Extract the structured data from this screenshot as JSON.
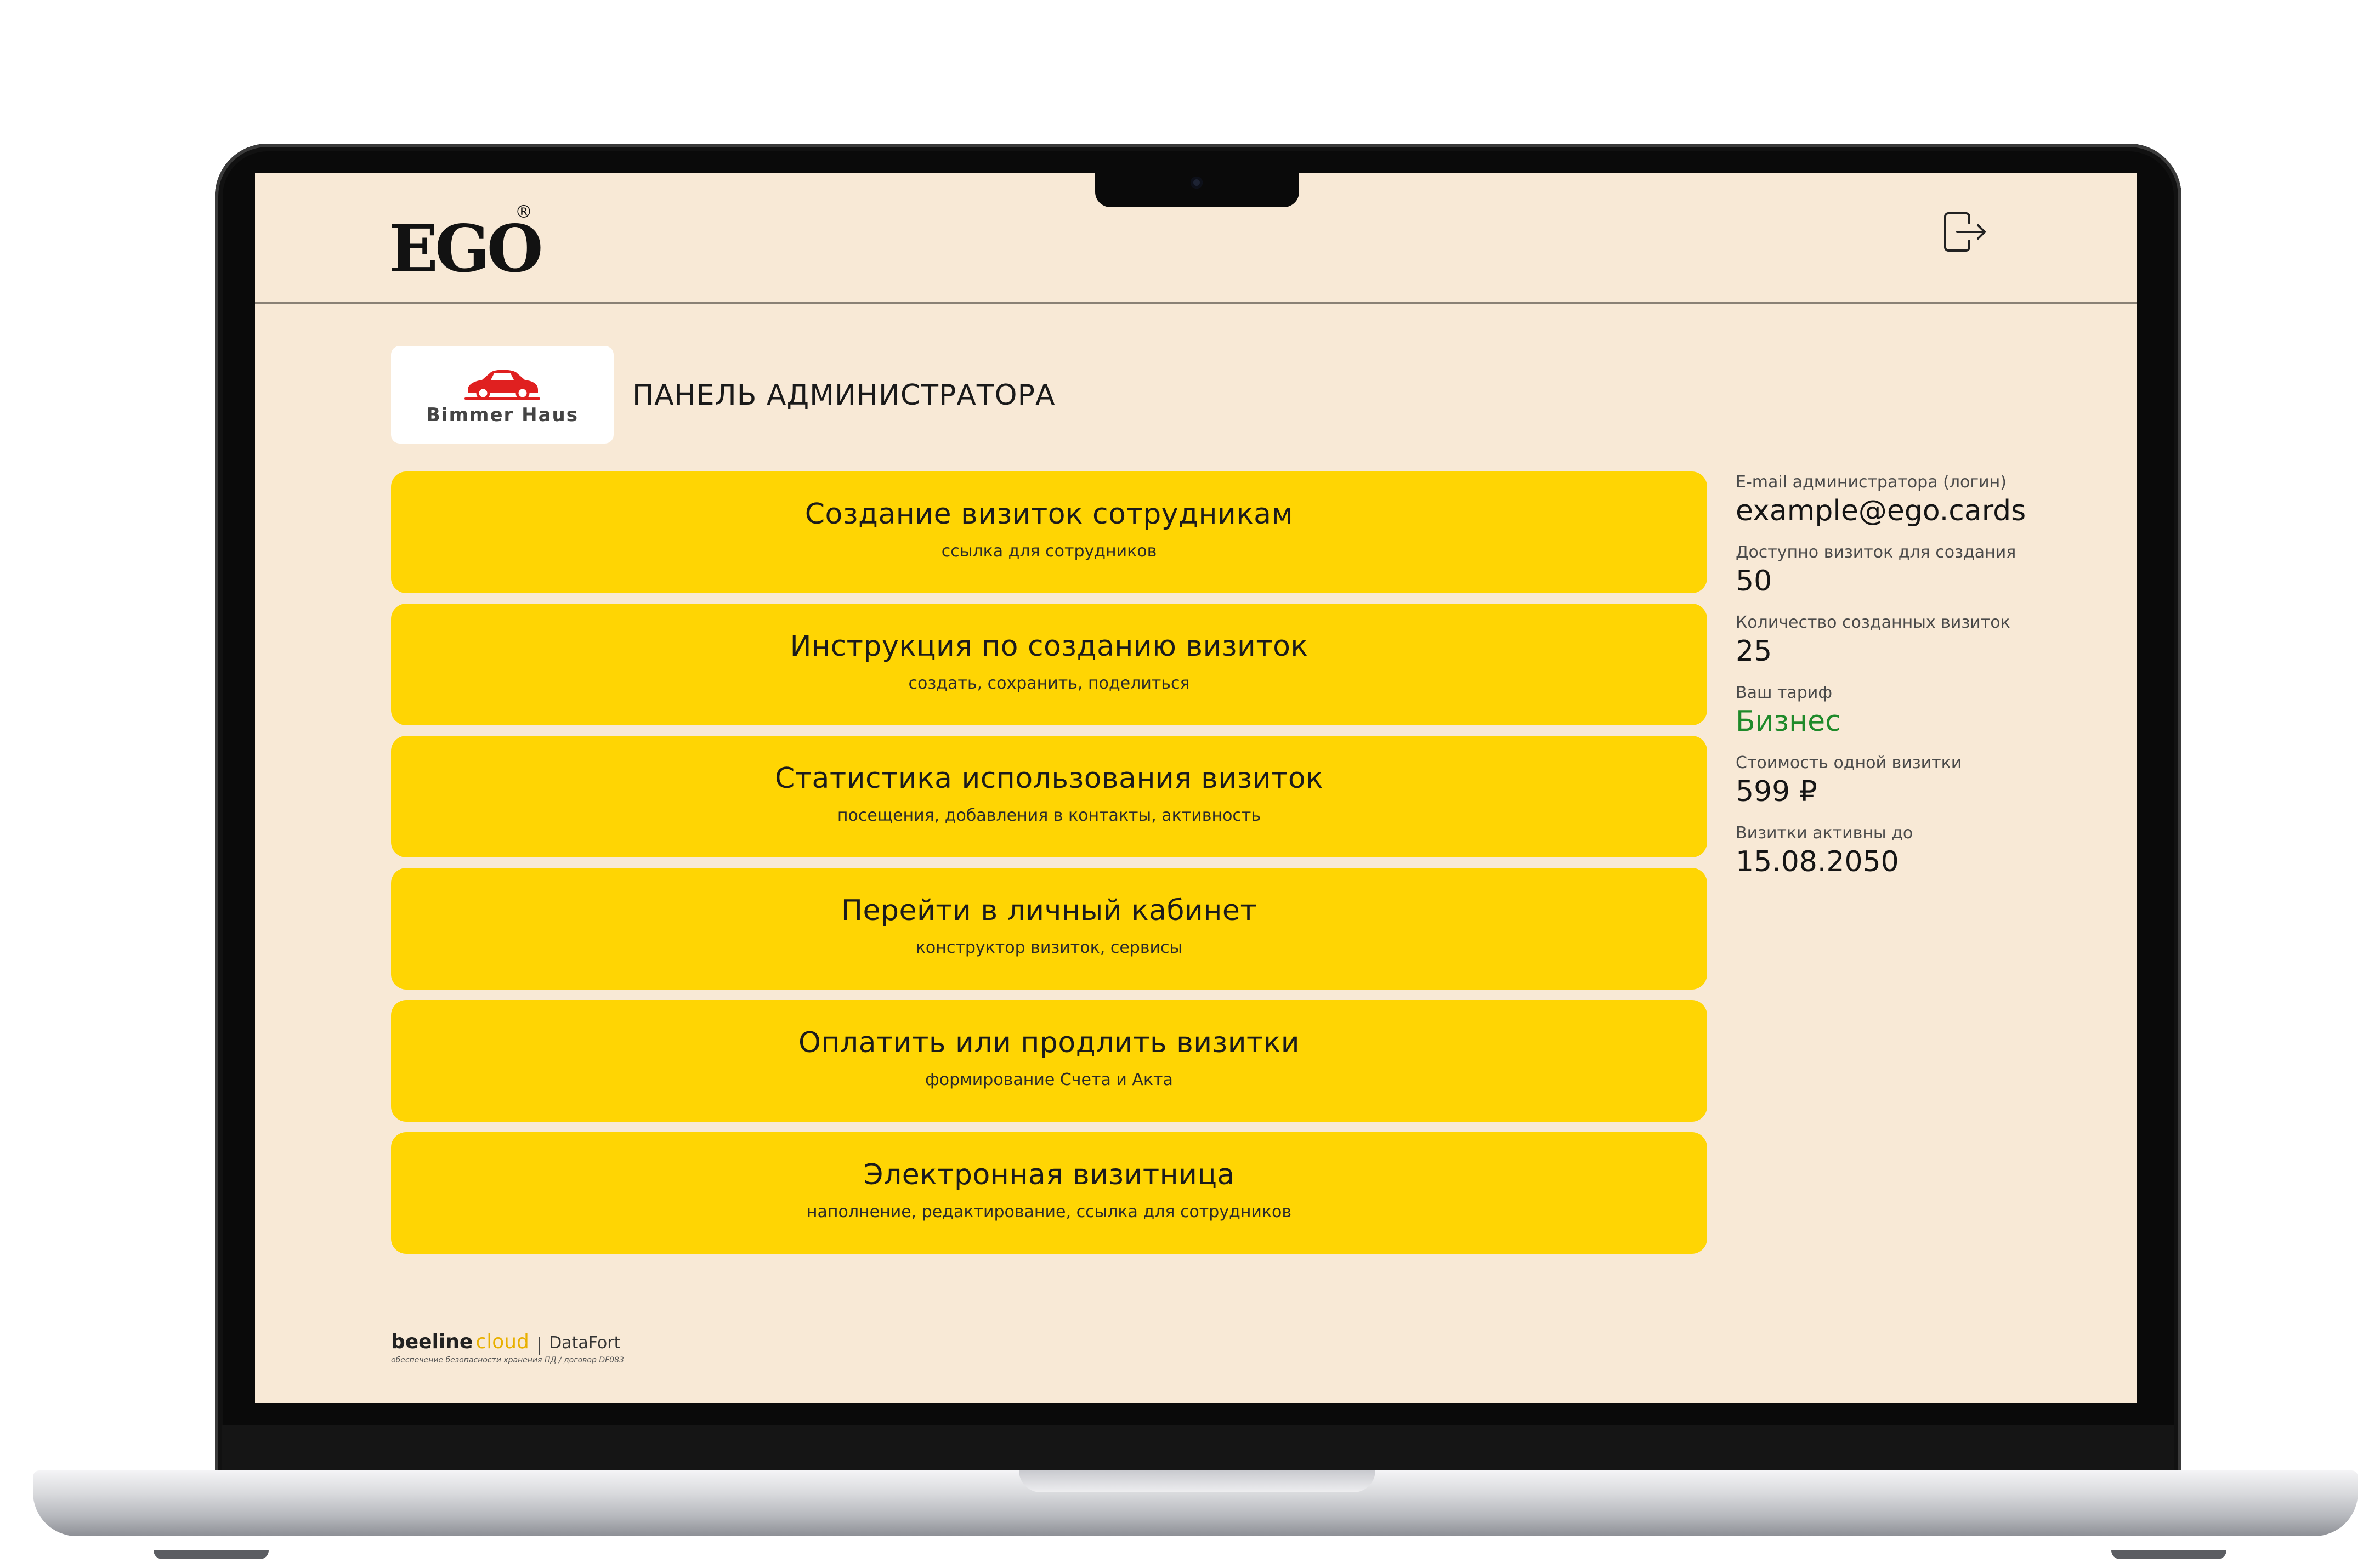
{
  "header": {
    "logo_text": "EGO",
    "logo_mark": "®",
    "logout_icon": "logout-icon"
  },
  "company": {
    "name": "Bimmer Haus",
    "logo_color": "#e02020"
  },
  "panel_title": "ПАНЕЛЬ АДМИНИСТРАТОРА",
  "menu": [
    {
      "title": "Создание визиток сотрудникам",
      "subtitle": "ссылка для сотрудников"
    },
    {
      "title": "Инструкция по созданию визиток",
      "subtitle": "создать, сохранить, поделиться"
    },
    {
      "title": "Статистика использования визиток",
      "subtitle": "посещения, добавления в контакты, активность"
    },
    {
      "title": "Перейти в личный кабинет",
      "subtitle": "конструктор визиток, сервисы"
    },
    {
      "title": "Оплатить или продлить визитки",
      "subtitle": "формирование Счета и Акта"
    },
    {
      "title": "Электронная визитница",
      "subtitle": "наполнение, редактирование, ссылка для сотрудников"
    }
  ],
  "info": {
    "email_label": "E-mail администратора (логин)",
    "email_value": "example@ego.cards",
    "available_label": "Доступно визиток для создания",
    "available_value": "50",
    "created_label": "Количество созданных визиток",
    "created_value": "25",
    "tariff_label": "Ваш тариф",
    "tariff_value": "Бизнес",
    "price_label": "Стоимость одной визитки",
    "price_value": "599 ₽",
    "active_label": "Визитки активны до",
    "active_value": "15.08.2050"
  },
  "footer": {
    "brand_main": "beeline",
    "brand_cloud": "cloud",
    "partner": "DataFort",
    "note": "обеспечение безопасности хранения ПД / договор DF083"
  },
  "colors": {
    "background": "#f8e9d6",
    "card": "#ffd503",
    "tariff_green": "#1f8a2a"
  }
}
